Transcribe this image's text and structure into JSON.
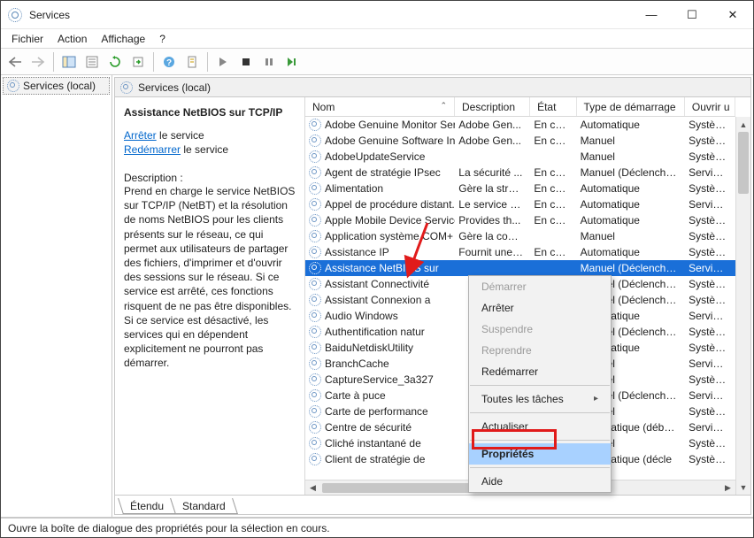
{
  "window": {
    "title": "Services"
  },
  "menubar": [
    "Fichier",
    "Action",
    "Affichage",
    "?"
  ],
  "tree": {
    "root": "Services (local)"
  },
  "panel_header": "Services (local)",
  "detail": {
    "title": "Assistance NetBIOS sur TCP/IP",
    "link1_text": "Arrêter",
    "link1_suffix": " le service",
    "link2_text": "Redémarrer",
    "link2_suffix": " le service",
    "desc_label": "Description :",
    "desc_text": "Prend en charge le service NetBIOS sur TCP/IP (NetBT) et la résolution de noms NetBIOS pour les clients présents sur le réseau, ce qui permet aux utilisateurs de partager des fichiers, d'imprimer et d'ouvrir des sessions sur le réseau. Si ce service est arrêté, ces fonctions risquent de ne pas être disponibles. Si ce service est désactivé, les services qui en dépendent explicitement ne pourront pas démarrer."
  },
  "columns": {
    "nom": "Nom",
    "desc": "Description",
    "etat": "État",
    "type": "Type de démarrage",
    "ouv": "Ouvrir u"
  },
  "rows": [
    {
      "n": "Adobe Genuine Monitor Ser...",
      "d": "Adobe Gen...",
      "e": "En co...",
      "t": "Automatique",
      "o": "Système"
    },
    {
      "n": "Adobe Genuine Software In...",
      "d": "Adobe Gen...",
      "e": "En co...",
      "t": "Manuel",
      "o": "Système"
    },
    {
      "n": "AdobeUpdateService",
      "d": "",
      "e": "",
      "t": "Manuel",
      "o": "Système"
    },
    {
      "n": "Agent de stratégie IPsec",
      "d": "La sécurité ...",
      "e": "En co...",
      "t": "Manuel (Déclencher...",
      "o": "Service r"
    },
    {
      "n": "Alimentation",
      "d": "Gère la strat...",
      "e": "En co...",
      "t": "Automatique",
      "o": "Système"
    },
    {
      "n": "Appel de procédure distant...",
      "d": "Le service R...",
      "e": "En co...",
      "t": "Automatique",
      "o": "Service r"
    },
    {
      "n": "Apple Mobile Device Service",
      "d": "Provides th...",
      "e": "En co...",
      "t": "Automatique",
      "o": "Système"
    },
    {
      "n": "Application système COM+",
      "d": "Gère la conf...",
      "e": "",
      "t": "Manuel",
      "o": "Système"
    },
    {
      "n": "Assistance IP",
      "d": "Fournit une ...",
      "e": "En co...",
      "t": "Automatique",
      "o": "Système"
    },
    {
      "n": "Assistance NetBIOS sur",
      "d": "",
      "e": "",
      "t": "Manuel (Déclencher...",
      "o": "Service l",
      "sel": true
    },
    {
      "n": "Assistant Connectivité",
      "d": "",
      "e": "",
      "t": "Manuel (Déclencher...",
      "o": "Système"
    },
    {
      "n": "Assistant Connexion a",
      "d": "",
      "e": "",
      "t": "Manuel (Déclencher...",
      "o": "Système"
    },
    {
      "n": "Audio Windows",
      "d": "",
      "e": "",
      "t": "Automatique",
      "o": "Service l"
    },
    {
      "n": "Authentification natur",
      "d": "",
      "e": "",
      "t": "Manuel (Déclencher...",
      "o": "Système"
    },
    {
      "n": "BaiduNetdiskUtility",
      "d": "",
      "e": "",
      "t": "Automatique",
      "o": "Système"
    },
    {
      "n": "BranchCache",
      "d": "",
      "e": "",
      "t": "Manuel",
      "o": "Service r"
    },
    {
      "n": "CaptureService_3a327",
      "d": "",
      "e": "",
      "t": "Manuel",
      "o": "Système"
    },
    {
      "n": "Carte à puce",
      "d": "",
      "e": "",
      "t": "Manuel (Déclencher...",
      "o": "Service l"
    },
    {
      "n": "Carte de performance",
      "d": "",
      "e": "",
      "t": "Manuel",
      "o": "Système"
    },
    {
      "n": "Centre de sécurité",
      "d": "",
      "e": "",
      "t": "Automatique (débu...",
      "o": "Service l"
    },
    {
      "n": "Cliché instantané de",
      "d": "",
      "e": "",
      "t": "Manuel",
      "o": "Système"
    },
    {
      "n": "Client de stratégie de",
      "d": "",
      "e": "",
      "t": "Automatique (décle",
      "o": "Système"
    }
  ],
  "tabs": {
    "etendu": "Étendu",
    "standard": "Standard"
  },
  "context_menu": {
    "demarrer": "Démarrer",
    "arreter": "Arrêter",
    "suspendre": "Suspendre",
    "reprendre": "Reprendre",
    "redemarrer": "Redémarrer",
    "toutes": "Toutes les tâches",
    "actualiser": "Actualiser",
    "proprietes": "Propriétés",
    "aide": "Aide"
  },
  "statusbar": "Ouvre la boîte de dialogue des propriétés pour la sélection en cours."
}
